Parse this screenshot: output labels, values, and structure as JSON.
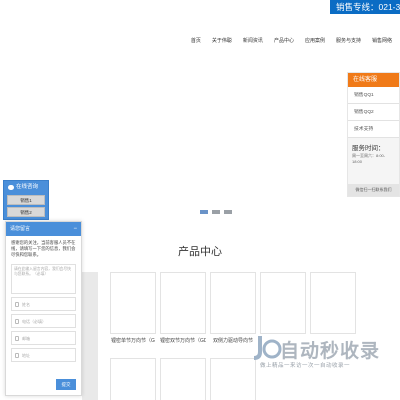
{
  "topbar": {
    "hotline": "销售专线：021-3"
  },
  "nav": {
    "items": [
      "首页",
      "关于伟聪",
      "新闻资讯",
      "产品中心",
      "应用案例",
      "服务与支持",
      "销售网络"
    ]
  },
  "products": {
    "title": "产品中心",
    "cards": [
      {
        "label": "锂密单节万向节（G"
      },
      {
        "label": "锂密双节万向节（GD"
      },
      {
        "label": "双侧力驱动导向节"
      },
      {
        "label": ""
      },
      {
        "label": ""
      }
    ]
  },
  "service_panel": {
    "title": "在线客服",
    "items": [
      "销售QQ1",
      "销售QQ2",
      "技术支持"
    ],
    "time_label": "服务时间：",
    "time_value": "周一至周六：8:00-18:00",
    "footer": "微信扫一扫联系我们"
  },
  "left_widget": {
    "title": "在线咨询",
    "buttons": [
      "销售1",
      "销售2"
    ]
  },
  "message_form": {
    "title": "请您留言",
    "intro": "感谢您的关注，当前客服人员不在线，请填写一下您的信息，我们会尽快和您联系。",
    "textarea_placeholder": "请在此输入留言内容，我们会尽快与您联系。（必填）",
    "fields": [
      "姓名",
      "电话（必填）",
      "邮箱",
      "地址"
    ],
    "submit": "提交"
  },
  "watermark": {
    "title": "自动秒收录",
    "subtitle": "做上精品一来访一次一自动收录一"
  }
}
